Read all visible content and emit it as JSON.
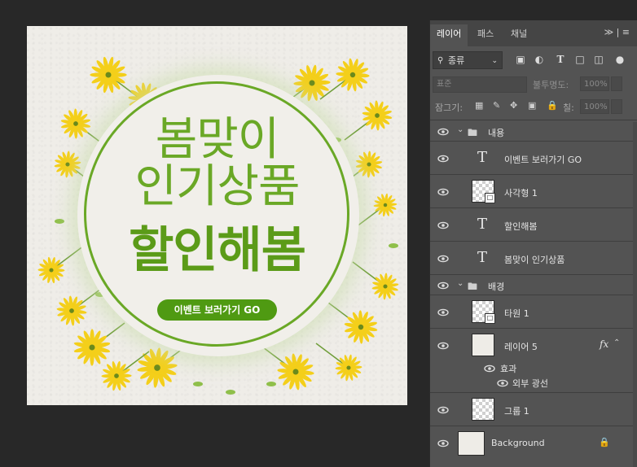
{
  "canvas": {
    "headline_line1": "봄맞이",
    "headline_line2": "인기상품",
    "headline_line3": "할인해봄",
    "cta_label": "이벤트 보러가기 GO",
    "accent_color": "#6aa826",
    "flower_color": "#f4cf1a"
  },
  "panel": {
    "tabs": [
      {
        "label": "레이어"
      },
      {
        "label": "패스"
      },
      {
        "label": "채널"
      }
    ],
    "tab_tools": "≫ | ≡",
    "filter": {
      "label": "종류"
    },
    "blend_mode": "표준",
    "opacity_label": "불투명도:",
    "opacity_value": "100%",
    "lock_label": "잠그기:",
    "fill_label": "칠:",
    "fill_value": "100%",
    "layers": [
      {
        "name": "내용",
        "kind": "group"
      },
      {
        "name": "이벤트 보러가기 GO",
        "kind": "text"
      },
      {
        "name": "사각형 1",
        "kind": "shape"
      },
      {
        "name": "할인해봄",
        "kind": "text"
      },
      {
        "name": "봄맞이 인기상품",
        "kind": "text"
      },
      {
        "name": "배경",
        "kind": "group"
      },
      {
        "name": "타원 1",
        "kind": "shape"
      },
      {
        "name": "레이어 5",
        "kind": "pixel",
        "fx": "fx"
      },
      {
        "name": "효과",
        "kind": "effects"
      },
      {
        "name": "외부 광선",
        "kind": "effect"
      },
      {
        "name": "그룹 1",
        "kind": "pixel"
      },
      {
        "name": "Background",
        "kind": "background"
      }
    ]
  }
}
